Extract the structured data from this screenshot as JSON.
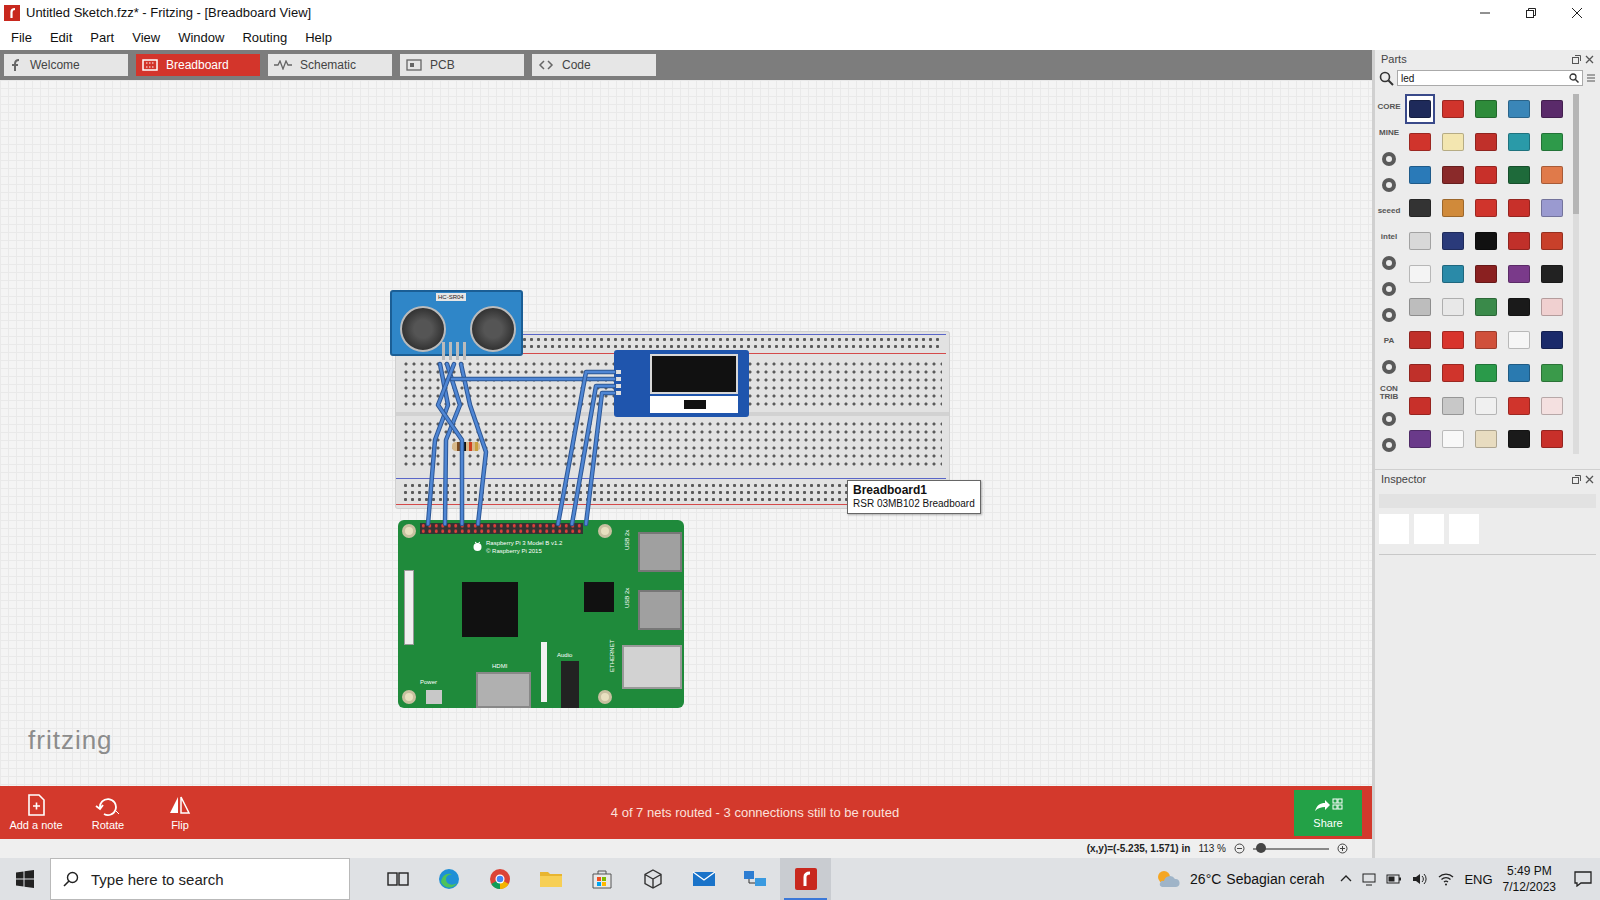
{
  "window": {
    "title": "Untitled Sketch.fzz* - Fritzing - [Breadboard View]"
  },
  "menu": [
    "File",
    "Edit",
    "Part",
    "View",
    "Window",
    "Routing",
    "Help"
  ],
  "tabs": [
    {
      "label": "Welcome",
      "selected": false
    },
    {
      "label": "Breadboard",
      "selected": true
    },
    {
      "label": "Schematic",
      "selected": false
    },
    {
      "label": "PCB",
      "selected": false
    },
    {
      "label": "Code",
      "selected": false
    }
  ],
  "canvas": {
    "tooltip": {
      "title": "Breadboard1",
      "subtitle": "RSR 03MB102 Breadboard"
    },
    "watermark": "fritzing",
    "sensor_label": "HC-SR04",
    "pi_labels": [
      "Raspberry Pi 3 Model B v1.2",
      "© Raspberry Pi 2015",
      "USB 2x",
      "USB 2x",
      "HDMI",
      "Audio",
      "Power",
      "ETHERNET"
    ]
  },
  "toolbar": {
    "buttons": [
      "Add a note",
      "Rotate",
      "Flip"
    ],
    "status": "4 of 7 nets routed - 3 connections still to be routed",
    "share": "Share"
  },
  "status_bar": {
    "coords": "(x,y)=(-5.235, 1.571) in",
    "zoom": "113 %",
    "zoom_level": 0.1
  },
  "parts": {
    "title": "Parts",
    "search": "led",
    "categories": [
      {
        "kind": "text",
        "label": "CORE"
      },
      {
        "kind": "text",
        "label": "MINE"
      },
      {
        "kind": "icon"
      },
      {
        "kind": "icon"
      },
      {
        "kind": "text",
        "label": "seeed"
      },
      {
        "kind": "text",
        "label": "intel"
      },
      {
        "kind": "icon"
      },
      {
        "kind": "icon"
      },
      {
        "kind": "icon"
      },
      {
        "kind": "text",
        "label": "PA"
      },
      {
        "kind": "icon"
      },
      {
        "kind": "text",
        "label": "CON TRIB"
      },
      {
        "kind": "icon"
      },
      {
        "kind": "icon"
      }
    ],
    "items": [
      {
        "color": "#1e2a5a",
        "selected": true
      },
      {
        "color": "#d0342c",
        "selected": false
      },
      {
        "color": "#2e8b3a",
        "selected": false
      },
      {
        "color": "#3a86b8",
        "selected": false
      },
      {
        "color": "#5a2a6a",
        "selected": false
      },
      {
        "color": "#d0342c",
        "selected": false
      },
      {
        "color": "#f3e6b0",
        "selected": false
      },
      {
        "color": "#c0302a",
        "selected": false
      },
      {
        "color": "#2a9aa8",
        "selected": false
      },
      {
        "color": "#2e9a4a",
        "selected": false
      },
      {
        "color": "#2a7ab8",
        "selected": false
      },
      {
        "color": "#8a2a2a",
        "selected": false
      },
      {
        "color": "#c8302a",
        "selected": false
      },
      {
        "color": "#1e6a3a",
        "selected": false
      },
      {
        "color": "#e07a4a",
        "selected": false
      },
      {
        "color": "#333333",
        "selected": false
      },
      {
        "color": "#d08a3a",
        "selected": false
      },
      {
        "color": "#d0342c",
        "selected": false
      },
      {
        "color": "#c8302a",
        "selected": false
      },
      {
        "color": "#9a9ad0",
        "selected": false
      },
      {
        "color": "#d8d8d8",
        "selected": false
      },
      {
        "color": "#2a3a7a",
        "selected": false
      },
      {
        "color": "#111111",
        "selected": false
      },
      {
        "color": "#c0302a",
        "selected": false
      },
      {
        "color": "#c8402a",
        "selected": false
      },
      {
        "color": "#f4f4f4",
        "selected": false
      },
      {
        "color": "#2a8aa8",
        "selected": false
      },
      {
        "color": "#8a2020",
        "selected": false
      },
      {
        "color": "#7a3a8a",
        "selected": false
      },
      {
        "color": "#222222",
        "selected": false
      },
      {
        "color": "#bdbdbd",
        "selected": false
      },
      {
        "color": "#e8e8e8",
        "selected": false
      },
      {
        "color": "#3a8a4a",
        "selected": false
      },
      {
        "color": "#1a1a1a",
        "selected": false
      },
      {
        "color": "#f0d0d0",
        "selected": false
      },
      {
        "color": "#c0302a",
        "selected": false
      },
      {
        "color": "#d8342c",
        "selected": false
      },
      {
        "color": "#d0503a",
        "selected": false
      },
      {
        "color": "#f6f6f6",
        "selected": false
      },
      {
        "color": "#1a2a6a",
        "selected": false
      },
      {
        "color": "#c0302a",
        "selected": false
      },
      {
        "color": "#d0342c",
        "selected": false
      },
      {
        "color": "#2a9a4a",
        "selected": false
      },
      {
        "color": "#2a7ab0",
        "selected": false
      },
      {
        "color": "#3a9a4a",
        "selected": false
      },
      {
        "color": "#c8302a",
        "selected": false
      },
      {
        "color": "#c8c8c8",
        "selected": false
      },
      {
        "color": "#f0f0f0",
        "selected": false
      },
      {
        "color": "#d0342c",
        "selected": false
      },
      {
        "color": "#f4e0e0",
        "selected": false
      },
      {
        "color": "#6a3a8a",
        "selected": false
      },
      {
        "color": "#f8f8f8",
        "selected": false
      },
      {
        "color": "#e8dcc0",
        "selected": false
      },
      {
        "color": "#1a1a1a",
        "selected": false
      },
      {
        "color": "#c8302a",
        "selected": false
      }
    ]
  },
  "inspector": {
    "title": "Inspector"
  },
  "taskbar": {
    "search": {
      "placeholder": "Type here to search"
    },
    "apps": [
      {
        "kind": "taskview",
        "active": false
      },
      {
        "kind": "edge",
        "active": false
      },
      {
        "kind": "chrome",
        "active": false
      },
      {
        "kind": "explorer",
        "active": false
      },
      {
        "kind": "store",
        "active": false
      },
      {
        "kind": "box3d",
        "active": false
      },
      {
        "kind": "mail",
        "active": false
      },
      {
        "kind": "network",
        "active": false
      },
      {
        "kind": "fritzing",
        "active": true
      }
    ],
    "weather": {
      "temp": "26°C",
      "text": "Sebagian cerah"
    },
    "language": "ENG",
    "time": "5:49 PM",
    "date": "7/12/2023"
  }
}
